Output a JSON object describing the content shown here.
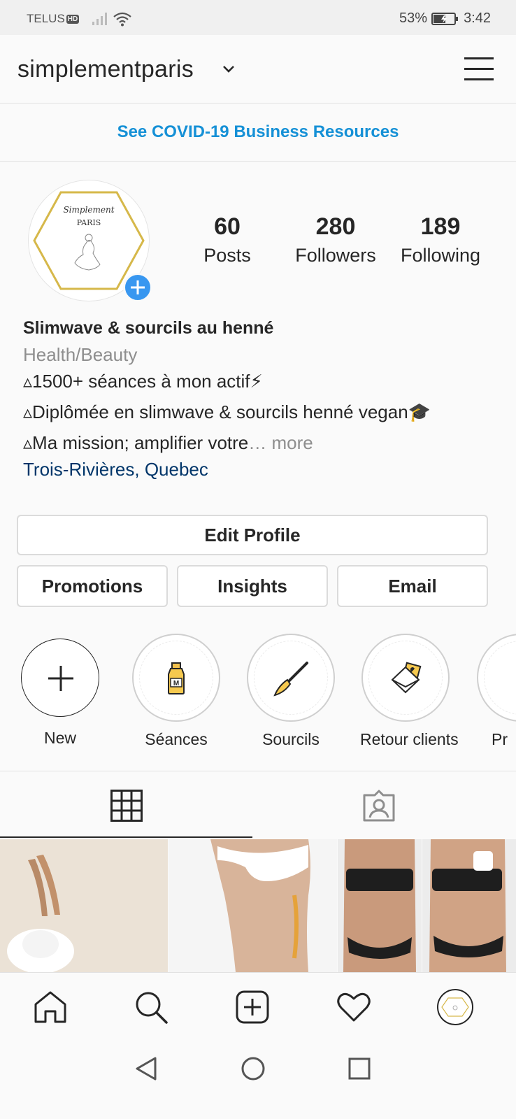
{
  "status_bar": {
    "carrier": "TELUS",
    "hd_badge": "HD",
    "battery_percent": "53%",
    "time": "3:42"
  },
  "header": {
    "username": "simplementparis",
    "icons": [
      "chevron-down-icon",
      "hamburger-menu-icon"
    ]
  },
  "banner": {
    "text": "See COVID-19 Business Resources",
    "color": "#1590d6"
  },
  "profile": {
    "avatar_logo_text": [
      "Simplement",
      "PARIS"
    ],
    "stats": [
      {
        "count": "60",
        "label": "Posts"
      },
      {
        "count": "280",
        "label": "Followers"
      },
      {
        "count": "189",
        "label": "Following"
      }
    ],
    "name": "Slimwave & sourcils au henné",
    "category": "Health/Beauty",
    "bio_lines": [
      "▵1500+ séances à mon actif⚡",
      "▵Diplômée en slimwave & sourcils henné vegan🎓",
      "▵Ma mission; amplifier votre"
    ],
    "more_label": "… more",
    "location": "Trois-Rivières, Quebec"
  },
  "actions": {
    "edit_profile": "Edit Profile",
    "promotions": "Promotions",
    "insights": "Insights",
    "email": "Email"
  },
  "highlights": [
    {
      "label": "New",
      "icon": "plus-icon"
    },
    {
      "label": "Séances",
      "icon": "bottle-icon"
    },
    {
      "label": "Sourcils",
      "icon": "brush-icon"
    },
    {
      "label": "Retour clients",
      "icon": "envelope-heart-icon"
    },
    {
      "label": "Pr",
      "icon": "partial-highlight"
    }
  ],
  "tabs": [
    "grid-icon",
    "tagged-icon"
  ],
  "bottom_nav": [
    "home-icon",
    "search-icon",
    "new-post-icon",
    "heart-icon",
    "profile-avatar"
  ],
  "colors": {
    "accent_blue": "#3897f0",
    "link_dark_blue": "#003569",
    "muted_text": "#8e8e8e"
  }
}
